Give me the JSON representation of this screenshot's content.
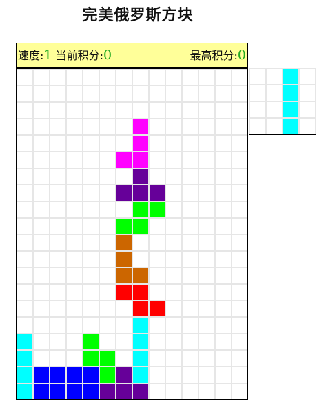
{
  "title": "完美俄罗斯方块",
  "status": {
    "speed_label": "速度:",
    "speed_value": "1",
    "score_label": "当前积分:",
    "score_value": "0",
    "high_label": "最高积分:",
    "high_value": "0"
  },
  "colors": {
    "grid_line": "#e6e6e6",
    "status_bg": "#ffff99",
    "number_green": "#22aa22"
  },
  "board": {
    "columns": 14,
    "rows": 20,
    "cells": [
      {
        "col": 7,
        "row": 3,
        "color": "#ff00ff"
      },
      {
        "col": 7,
        "row": 4,
        "color": "#ff00ff"
      },
      {
        "col": 6,
        "row": 5,
        "color": "#ff00ff"
      },
      {
        "col": 7,
        "row": 5,
        "color": "#ff00ff"
      },
      {
        "col": 7,
        "row": 6,
        "color": "#660099"
      },
      {
        "col": 6,
        "row": 7,
        "color": "#660099"
      },
      {
        "col": 7,
        "row": 7,
        "color": "#660099"
      },
      {
        "col": 8,
        "row": 7,
        "color": "#660099"
      },
      {
        "col": 7,
        "row": 8,
        "color": "#00ff00"
      },
      {
        "col": 8,
        "row": 8,
        "color": "#00ff00"
      },
      {
        "col": 6,
        "row": 9,
        "color": "#00ff00"
      },
      {
        "col": 7,
        "row": 9,
        "color": "#00ff00"
      },
      {
        "col": 6,
        "row": 10,
        "color": "#cc6600"
      },
      {
        "col": 6,
        "row": 11,
        "color": "#cc6600"
      },
      {
        "col": 6,
        "row": 12,
        "color": "#cc6600"
      },
      {
        "col": 7,
        "row": 12,
        "color": "#cc6600"
      },
      {
        "col": 6,
        "row": 13,
        "color": "#ff0000"
      },
      {
        "col": 7,
        "row": 13,
        "color": "#ff0000"
      },
      {
        "col": 7,
        "row": 14,
        "color": "#ff0000"
      },
      {
        "col": 8,
        "row": 14,
        "color": "#ff0000"
      },
      {
        "col": 7,
        "row": 15,
        "color": "#00ffff"
      },
      {
        "col": 7,
        "row": 16,
        "color": "#00ffff"
      },
      {
        "col": 7,
        "row": 17,
        "color": "#00ffff"
      },
      {
        "col": 7,
        "row": 18,
        "color": "#00ffff"
      },
      {
        "col": 0,
        "row": 16,
        "color": "#00ffff"
      },
      {
        "col": 0,
        "row": 17,
        "color": "#00ffff"
      },
      {
        "col": 0,
        "row": 18,
        "color": "#00ffff"
      },
      {
        "col": 0,
        "row": 19,
        "color": "#00ffff"
      },
      {
        "col": 4,
        "row": 16,
        "color": "#00ff00"
      },
      {
        "col": 4,
        "row": 17,
        "color": "#00ff00"
      },
      {
        "col": 5,
        "row": 17,
        "color": "#00ff00"
      },
      {
        "col": 5,
        "row": 18,
        "color": "#00ff00"
      },
      {
        "col": 1,
        "row": 18,
        "color": "#0000ff"
      },
      {
        "col": 2,
        "row": 18,
        "color": "#0000ff"
      },
      {
        "col": 3,
        "row": 18,
        "color": "#0000ff"
      },
      {
        "col": 4,
        "row": 18,
        "color": "#0000ff"
      },
      {
        "col": 1,
        "row": 19,
        "color": "#0000ff"
      },
      {
        "col": 2,
        "row": 19,
        "color": "#0000ff"
      },
      {
        "col": 3,
        "row": 19,
        "color": "#0000ff"
      },
      {
        "col": 4,
        "row": 19,
        "color": "#0000ff"
      },
      {
        "col": 6,
        "row": 18,
        "color": "#660099"
      },
      {
        "col": 5,
        "row": 19,
        "color": "#660099"
      },
      {
        "col": 6,
        "row": 19,
        "color": "#660099"
      },
      {
        "col": 7,
        "row": 19,
        "color": "#660099"
      }
    ]
  },
  "next_piece": {
    "columns": 4,
    "rows": 4,
    "cells": [
      {
        "col": 2,
        "row": 0,
        "color": "#00ffff"
      },
      {
        "col": 2,
        "row": 1,
        "color": "#00ffff"
      },
      {
        "col": 2,
        "row": 2,
        "color": "#00ffff"
      },
      {
        "col": 2,
        "row": 3,
        "color": "#00ffff"
      }
    ]
  }
}
